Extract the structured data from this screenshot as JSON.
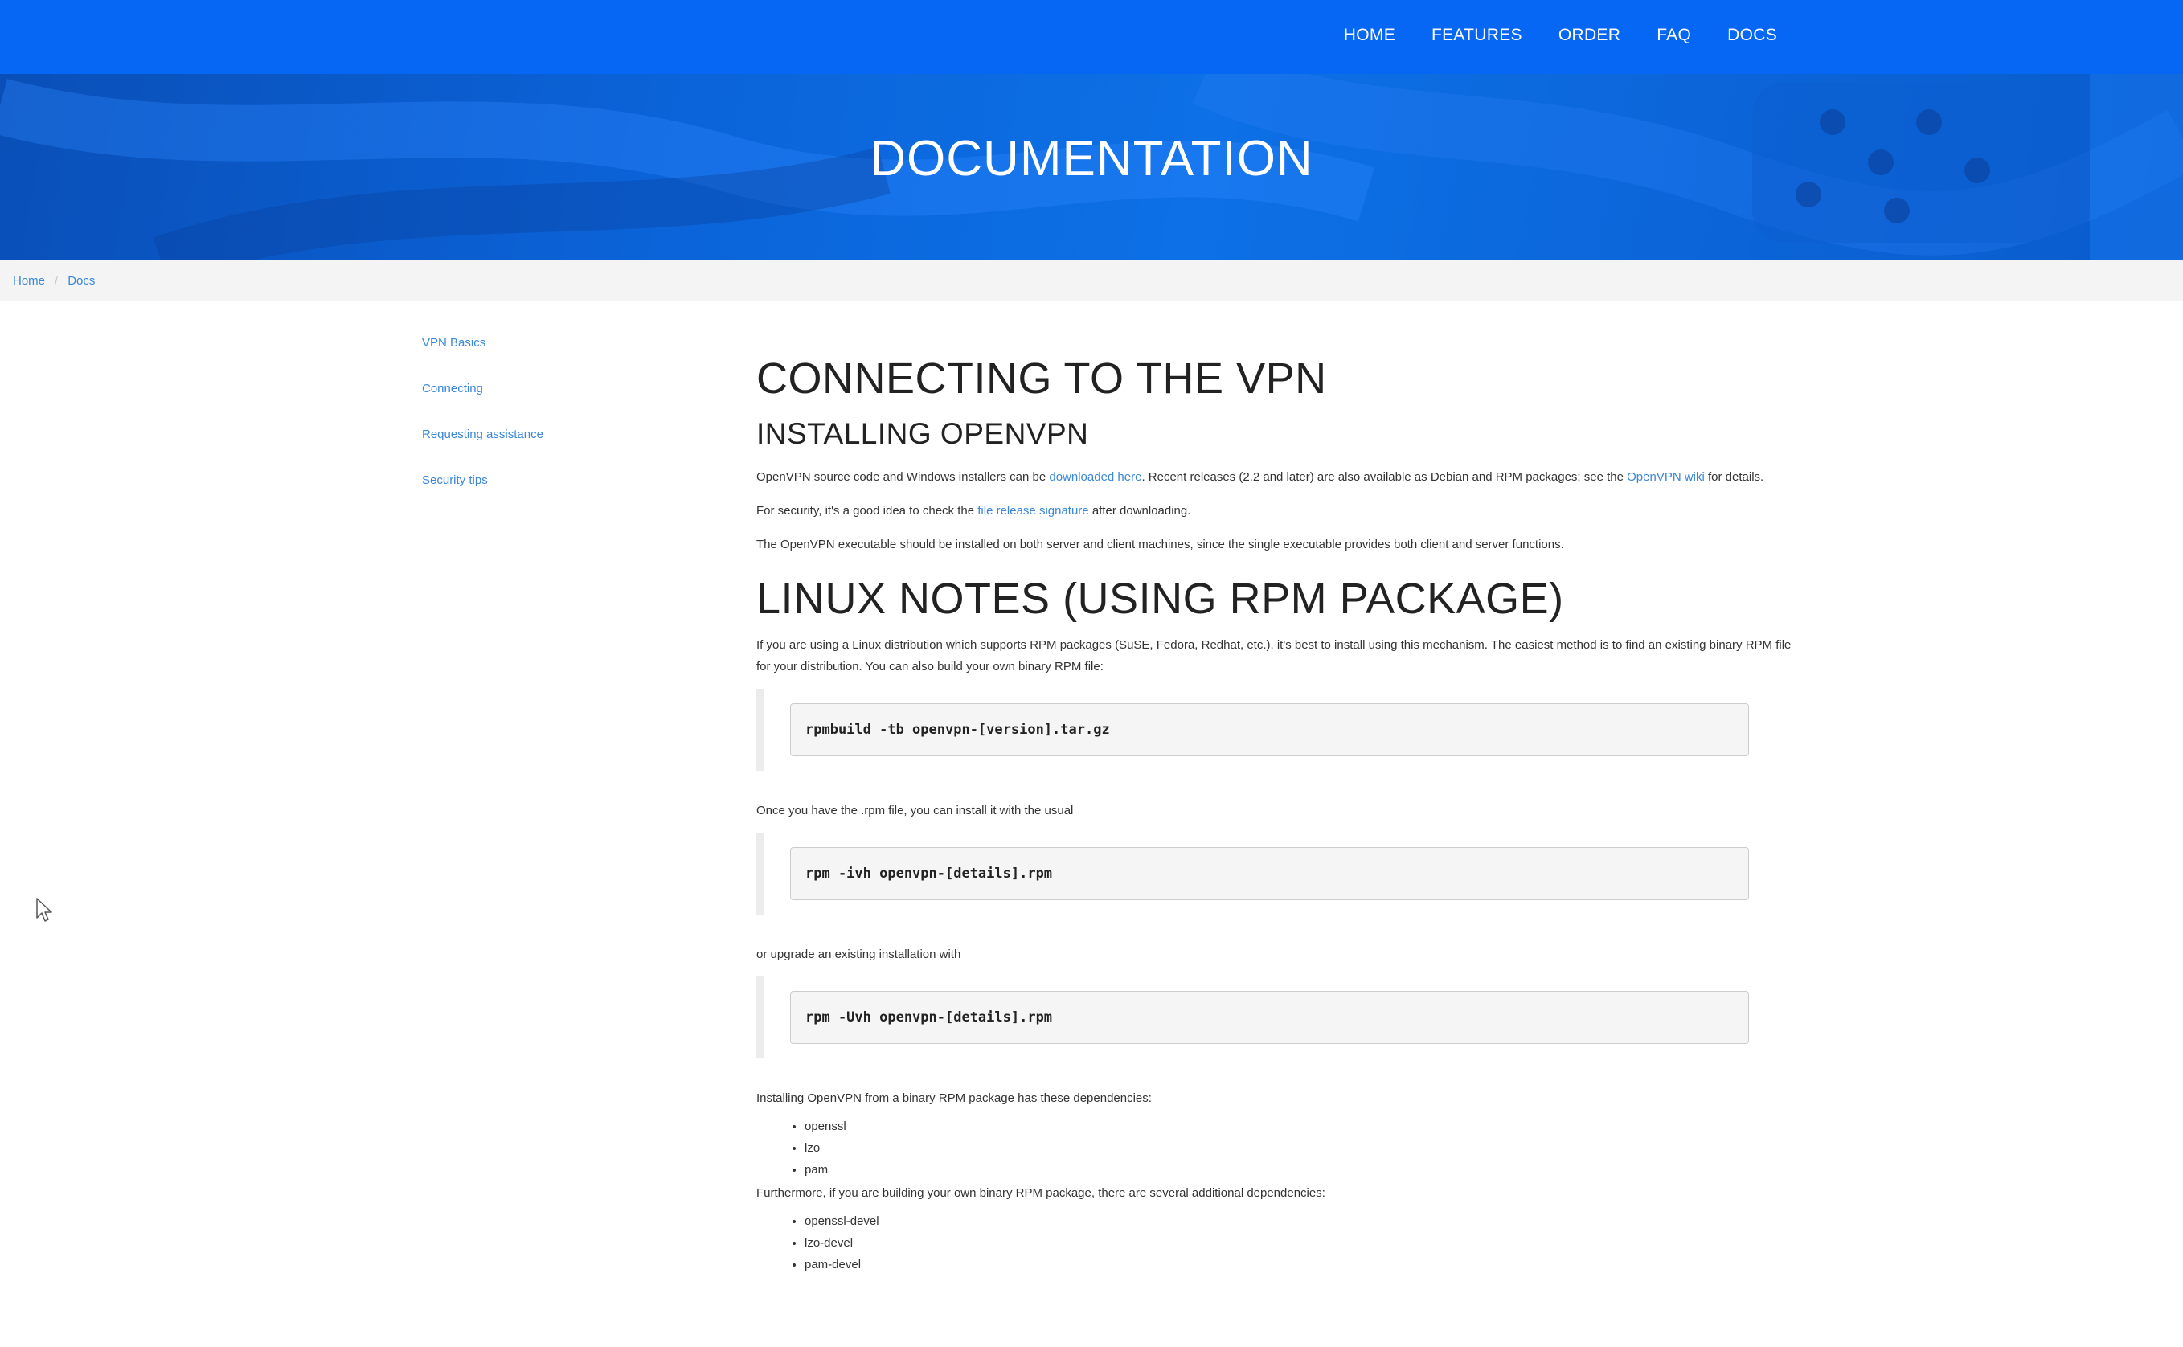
{
  "nav": {
    "items": [
      "HOME",
      "FEATURES",
      "ORDER",
      "FAQ",
      "DOCS"
    ]
  },
  "banner": {
    "title": "DOCUMENTATION"
  },
  "breadcrumb": {
    "home": "Home",
    "separator": "/",
    "current": "Docs"
  },
  "sidebar": {
    "items": [
      "VPN Basics",
      "Connecting",
      "Requesting assistance",
      "Security tips"
    ]
  },
  "content": {
    "title": "CONNECTING TO THE VPN",
    "install_heading": "INSTALLING OPENVPN",
    "p1": {
      "before": "OpenVPN source code and Windows installers can be ",
      "link1": "downloaded here",
      "middle": ". Recent releases (2.2 and later) are also available as Debian and RPM packages; see the ",
      "link2": "OpenVPN wiki",
      "after": " for details."
    },
    "p2": {
      "before": "For security, it's a good idea to check the ",
      "link": "file release signature",
      "after": " after downloading."
    },
    "p3": "The OpenVPN executable should be installed on both server and client machines, since the single executable provides both client and server functions.",
    "linux_heading": "LINUX NOTES (USING RPM PACKAGE)",
    "p4": "If you are using a Linux distribution which supports RPM packages (SuSE, Fedora, Redhat, etc.), it's best to install using this mechanism. The easiest method is to find an existing binary RPM file for your distribution. You can also build your own binary RPM file:",
    "code1": "rpmbuild -tb openvpn-[version].tar.gz",
    "p5": "Once you have the .rpm file, you can install it with the usual",
    "code2": "rpm -ivh openvpn-[details].rpm",
    "p6": "or upgrade an existing installation with",
    "code3": "rpm -Uvh openvpn-[details].rpm",
    "p7": "Installing OpenVPN from a binary RPM package has these dependencies:",
    "deps": [
      "openssl",
      "lzo",
      "pam"
    ],
    "p8": "Furthermore, if you are building your own binary RPM package, there are several additional dependencies:",
    "build_deps": [
      "openssl-devel",
      "lzo-devel",
      "pam-devel"
    ]
  },
  "colors": {
    "nav_bg": "#0567f4",
    "link": "#3a87d9",
    "banner": "#0b63d8"
  }
}
